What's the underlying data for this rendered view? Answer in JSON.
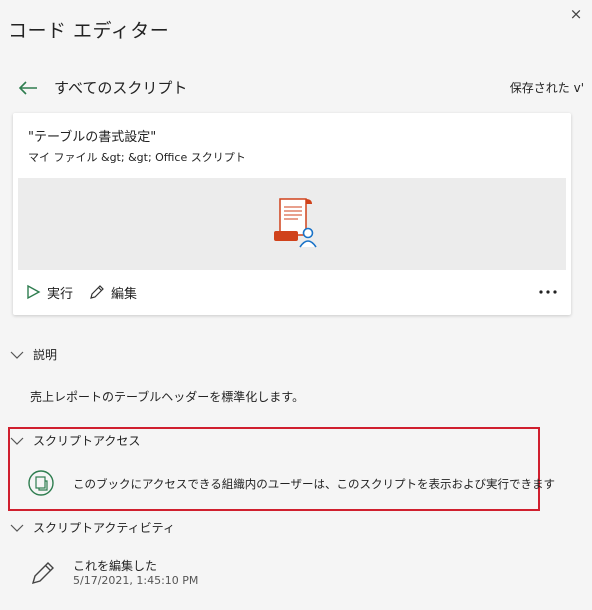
{
  "header": {
    "title": "コード エディター",
    "close_label": "×"
  },
  "nav": {
    "back_label": "すべてのスクリプト",
    "saved_label": "保存された v'"
  },
  "script_card": {
    "name": "\"テーブルの書式設定\"",
    "path": "マイ ファイル &gt; &gt; Office スクリプト",
    "run_label": "実行",
    "edit_label": "編集",
    "more_label": "•••"
  },
  "sections": {
    "description": {
      "heading": "説明",
      "text": "売上レポートのテーブルヘッダーを標準化します。"
    },
    "access": {
      "heading": "スクリプトアクセス",
      "text": "このブックにアクセスできる組織内のユーザーは、このスクリプトを表示および実行できます"
    },
    "activity": {
      "heading": "スクリプトアクティビティ",
      "action": "これを編集した",
      "timestamp": "5/17/2021, 1:45:10 PM"
    }
  },
  "colors": {
    "accent_green": "#2e7d4f",
    "highlight_red": "#d01f2e",
    "script_icon_red": "#d0421b",
    "user_icon_blue": "#1a73c8"
  },
  "icons": {
    "back": "arrow-left-icon",
    "close": "close-icon",
    "run": "play-icon",
    "edit": "pencil-icon",
    "more": "ellipsis-icon",
    "script": "script-scroll-user-icon",
    "access": "shared-document-icon",
    "activity": "pencil-icon"
  }
}
